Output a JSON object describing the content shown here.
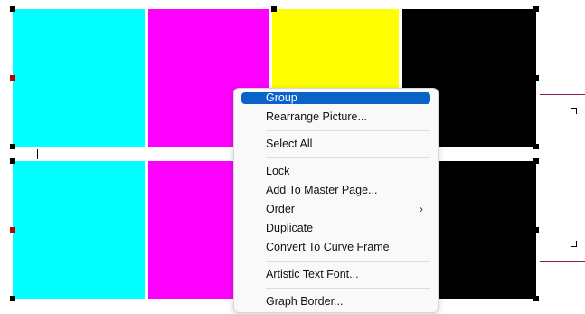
{
  "canvas": {
    "swatches": [
      {
        "name": "cyan-swatch-top",
        "color": "#00FFFF"
      },
      {
        "name": "magenta-swatch-top",
        "color": "#FF00FF"
      },
      {
        "name": "yellow-swatch-top",
        "color": "#FFFF00"
      },
      {
        "name": "black-swatch-top",
        "color": "#000000"
      },
      {
        "name": "cyan-swatch-bottom",
        "color": "#00FFFF"
      },
      {
        "name": "magenta-swatch-bottom",
        "color": "#FF00FF"
      },
      {
        "name": "black-swatch-bottom",
        "color": "#000000"
      }
    ],
    "guide_color": "#8B1A5A"
  },
  "context_menu": {
    "items": [
      {
        "label": "Group",
        "highlighted": true
      },
      {
        "label": "Rearrange Picture..."
      },
      {
        "label": "Select All"
      },
      {
        "label": "Lock"
      },
      {
        "label": "Add To Master Page..."
      },
      {
        "label": "Order",
        "submenu": true,
        "arrow": "›"
      },
      {
        "label": "Duplicate"
      },
      {
        "label": "Convert To Curve Frame"
      },
      {
        "label": "Artistic Text Font..."
      },
      {
        "label": "Graph Border..."
      }
    ],
    "highlight_color": "#0A64C8"
  }
}
